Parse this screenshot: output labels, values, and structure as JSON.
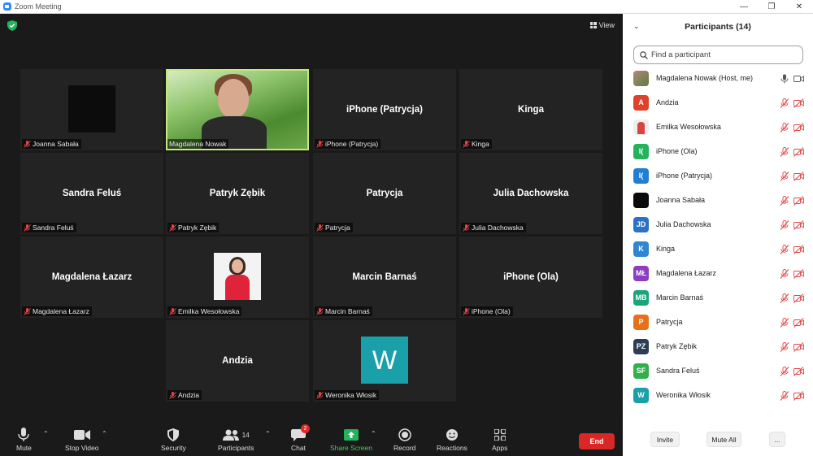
{
  "window": {
    "title": "Zoom Meeting",
    "minimize": "—",
    "restore": "❐",
    "close": "✕"
  },
  "view": {
    "label": "View"
  },
  "tiles": [
    {
      "name": "Joanna Sabała",
      "center": ""
    },
    {
      "name": "Magdalena Nowak",
      "center": ""
    },
    {
      "name": "iPhone (Patrycja)",
      "center": "iPhone (Patrycja)"
    },
    {
      "name": "Kinga",
      "center": "Kinga"
    },
    {
      "name": "Sandra Feluś",
      "center": "Sandra Feluś"
    },
    {
      "name": "Patryk Zębik",
      "center": "Patryk Zębik"
    },
    {
      "name": "Patrycja",
      "center": "Patrycja"
    },
    {
      "name": "Julia Dachowska",
      "center": "Julia Dachowska"
    },
    {
      "name": "Magdalena Łazarz",
      "center": "Magdalena Łazarz"
    },
    {
      "name": "Emilka Wesołowska",
      "center": ""
    },
    {
      "name": "Marcin Barnaś",
      "center": "Marcin Barnaś"
    },
    {
      "name": "iPhone (Ola)",
      "center": "iPhone (Ola)"
    },
    {
      "name": "Andzia",
      "center": "Andzia"
    },
    {
      "name": "Weronika Włosik",
      "center": "",
      "avatar_letter": "W"
    }
  ],
  "toolbar": {
    "mute": "Mute",
    "stop_video": "Stop Video",
    "security": "Security",
    "participants": "Participants",
    "participants_count": "14",
    "chat": "Chat",
    "chat_badge": "2",
    "share_screen": "Share Screen",
    "record": "Record",
    "reactions": "Reactions",
    "apps": "Apps",
    "end": "End"
  },
  "panel": {
    "title": "Participants (14)",
    "search_placeholder": "Find a participant",
    "participants": [
      {
        "name": "Magdalena Nowak (Host, me)",
        "initials": "",
        "color": "#8a6a55",
        "muted": false
      },
      {
        "name": "Andzia",
        "initials": "A",
        "color": "#e0412b",
        "muted": true
      },
      {
        "name": "Emilka Wesołowska",
        "initials": "",
        "color": "#c9c9c9",
        "muted": true
      },
      {
        "name": "iPhone (Ola)",
        "initials": "I(",
        "color": "#23b35b",
        "muted": true
      },
      {
        "name": "iPhone (Patrycja)",
        "initials": "I(",
        "color": "#1f7ed6",
        "muted": true
      },
      {
        "name": "Joanna Sabała",
        "initials": "",
        "color": "#0b0b0b",
        "muted": true
      },
      {
        "name": "Julia Dachowska",
        "initials": "JD",
        "color": "#2b72c4",
        "muted": true
      },
      {
        "name": "Kinga",
        "initials": "K",
        "color": "#2f86d1",
        "muted": true
      },
      {
        "name": "Magdalena Łazarz",
        "initials": "MŁ",
        "color": "#8a3fbf",
        "muted": true
      },
      {
        "name": "Marcin Barnaś",
        "initials": "MB",
        "color": "#1aa57a",
        "muted": true
      },
      {
        "name": "Patrycja",
        "initials": "P",
        "color": "#e6711b",
        "muted": true
      },
      {
        "name": "Patryk Zębik",
        "initials": "PZ",
        "color": "#2c3e55",
        "muted": true
      },
      {
        "name": "Sandra Feluś",
        "initials": "SF",
        "color": "#2fb04a",
        "muted": true
      },
      {
        "name": "Weronika Włosik",
        "initials": "W",
        "color": "#1aa0a8",
        "muted": true
      }
    ],
    "invite": "Invite",
    "mute_all": "Mute All",
    "more": "..."
  }
}
